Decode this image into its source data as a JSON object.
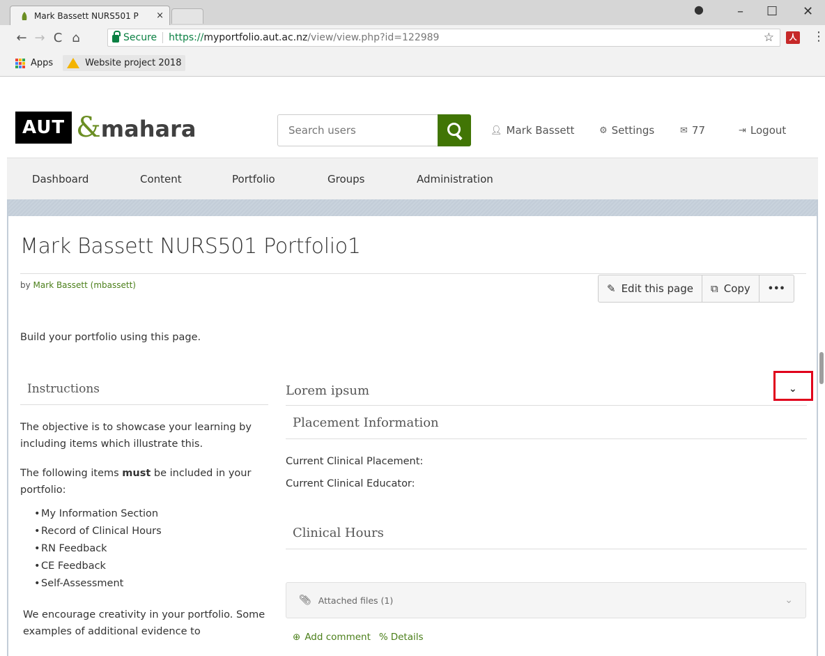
{
  "browser": {
    "tab_title": "Mark Bassett NURS501 P",
    "tab_close": "×",
    "url_scheme": "https://",
    "url_host": "myportfolio.aut.ac.nz",
    "url_path": "/view/view.php?id=122989",
    "secure_label": "Secure",
    "star": "☆",
    "pdf_ext": "人",
    "menu": "⋮",
    "window_controls": {
      "minimize": "–",
      "maximize": "☐",
      "close": "✕"
    },
    "nav": {
      "back": "←",
      "forward": "→",
      "reload": "C",
      "home": "⌂"
    }
  },
  "bookmarks": {
    "apps": "Apps",
    "items": [
      {
        "label": "Website project 2018"
      }
    ]
  },
  "header": {
    "logo_aut": "AUT",
    "logo_amp": "&",
    "logo_mahara": "mahara",
    "search_placeholder": "Search users",
    "user": "Mark Bassett",
    "settings": "Settings",
    "messages_count": "77",
    "logout": "Logout"
  },
  "nav": {
    "items": [
      {
        "label": "Dashboard"
      },
      {
        "label": "Content"
      },
      {
        "label": "Portfolio"
      },
      {
        "label": "Groups"
      },
      {
        "label": "Administration"
      }
    ]
  },
  "page": {
    "title": "Mark Bassett NURS501 Portfolio1",
    "by": "by ",
    "author": "Mark Bassett (mbassett)",
    "edit_label": "Edit this page",
    "copy_label": "Copy",
    "more_label": "•••",
    "intro": "Build your portfolio using this page."
  },
  "instructions": {
    "title": "Instructions",
    "p1": "The objective is to showcase your learning by including items which illustrate this.",
    "p2_before": "The following items ",
    "p2_bold": "must",
    "p2_after": " be included in your portfolio:",
    "list": [
      "My Information Section",
      "Record of Clinical Hours",
      "RN Feedback",
      "CE Feedback",
      "Self-Assessment"
    ],
    "p3": "We encourage creativity in your portfolio. Some examples of additional evidence to"
  },
  "right": {
    "lorem_title": "Lorem ipsum",
    "placement_title": "Placement Information",
    "placement_label": "Current Clinical Placement:",
    "educator_label": "Current Clinical Educator:",
    "hours_title": "Clinical Hours",
    "attached": "Attached files (1)",
    "add_comment": "Add comment",
    "details": "Details"
  },
  "colors": {
    "accent": "#417505",
    "link": "#4b7f1a",
    "highlight": "#e0001b"
  }
}
